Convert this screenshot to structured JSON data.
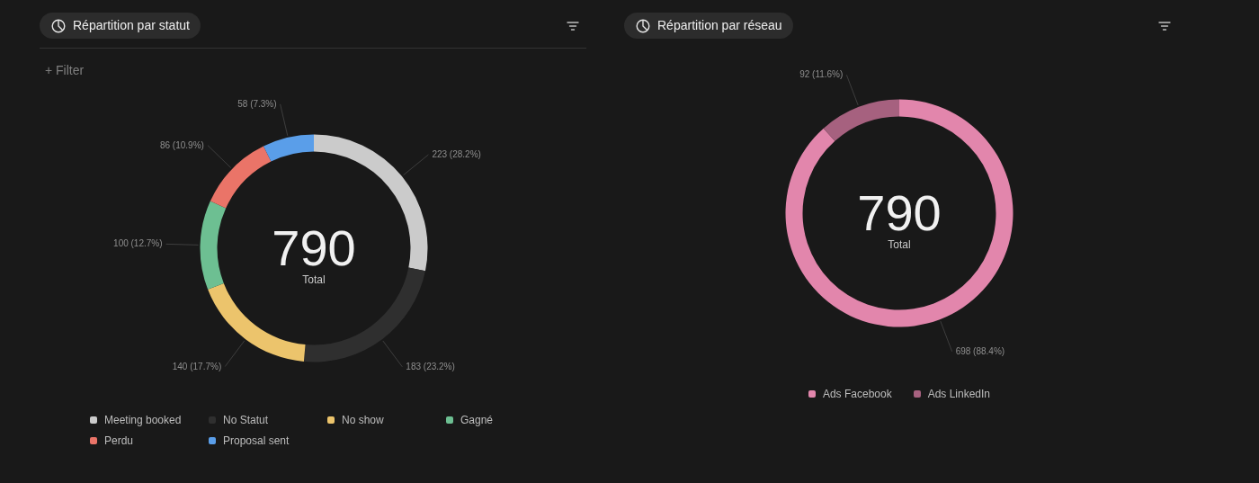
{
  "panels": [
    {
      "title": "Répartition par statut",
      "filter_label": "+ Filter",
      "total": "790",
      "total_label": "Total",
      "chart_data": {
        "type": "donut",
        "categories": [
          "Meeting booked",
          "No Statut",
          "No show",
          "Gagné",
          "Perdu",
          "Proposal sent"
        ],
        "series": [
          {
            "values": [
              28.2,
              23.2,
              17.7,
              12.7,
              10.9,
              7.3
            ]
          }
        ],
        "value_labels": [
          "223 (28.2%)",
          "183 (23.2%)",
          "140 (17.7%)",
          "100 (12.7%)",
          "86 (10.9%)",
          "58 (7.3%)"
        ]
      },
      "legend": [
        {
          "color": "#cbcbcb"
        },
        {
          "color": "#2f2f2f"
        },
        {
          "color": "#ecc46c"
        },
        {
          "color": "#6dbf92"
        },
        {
          "color": "#ea7468"
        },
        {
          "color": "#5a9ee9"
        }
      ]
    },
    {
      "title": "Répartition par réseau",
      "total": "790",
      "total_label": "Total",
      "chart_data": {
        "type": "donut",
        "categories": [
          "Ads Facebook",
          "Ads LinkedIn"
        ],
        "series": [
          {
            "values": [
              88.4,
              11.6
            ]
          }
        ],
        "value_labels": [
          "698 (88.4%)",
          "92 (11.6%)"
        ]
      },
      "legend": [
        {
          "color": "#e286ac"
        },
        {
          "color": "#a6617f"
        }
      ]
    }
  ]
}
